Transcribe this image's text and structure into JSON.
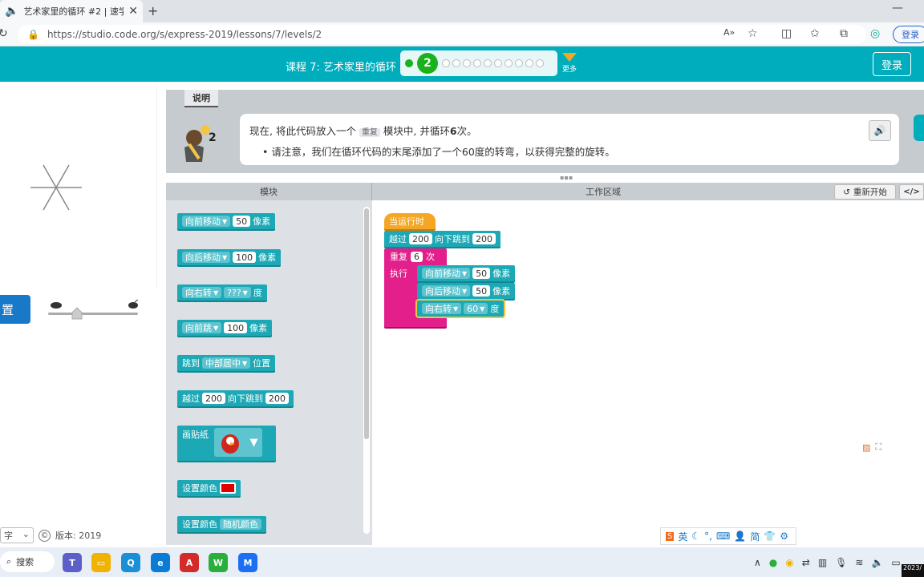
{
  "browser": {
    "tab_title": "艺术家里的循环 #2 | 速学课",
    "url": "https://studio.code.org/s/express-2019/lessons/7/levels/2",
    "login_pill": "登录"
  },
  "header": {
    "lesson_title": "课程 7: 艺术家里的循环",
    "current_level": "2",
    "more_label": "更多",
    "signin_label": "登录"
  },
  "viz": {
    "reset_label": "置",
    "footer_lang": "字",
    "footer_version": "版本: 2019",
    "footer_copyright": "©"
  },
  "instructions": {
    "tab_label": "说明",
    "line1_pre": "现在, 将此代码放入一个",
    "line1_kw": "重复",
    "line1_mid": "模块中, 并循环",
    "line1_num": "6",
    "line1_post": "次。",
    "bullet": "请注意，我们在循环代码的末尾添加了一个60度的转弯，以获得完整的旋转。",
    "avatar_badge": "2"
  },
  "workspace": {
    "toolbox_header": "模块",
    "workarea_header": "工作区域",
    "restart_label": "重新开始",
    "code_toggle_label": "</>"
  },
  "toolbox_blocks": {
    "b1": {
      "action": "向前移动",
      "value": "50",
      "unit": "像素"
    },
    "b2": {
      "action": "向后移动",
      "value": "100",
      "unit": "像素"
    },
    "b3": {
      "action": "向右转",
      "value": "???",
      "unit": "度"
    },
    "b4": {
      "action": "向前跳",
      "value": "100",
      "unit": "像素"
    },
    "b5": {
      "pre": "跳到",
      "value": "中部居中",
      "post": "位置"
    },
    "b6": {
      "pre": "越过",
      "x": "200",
      "mid": "向下跳到",
      "y": "200"
    },
    "b7": {
      "label": "画贴纸"
    },
    "b8": {
      "label": "设置颜色",
      "color": "#e00000"
    },
    "b9": {
      "label": "设置颜色",
      "value": "随机颜色"
    }
  },
  "program": {
    "event": "当运行时",
    "jump": {
      "pre": "越过",
      "x": "200",
      "mid": "向下跳到",
      "y": "200"
    },
    "repeat": {
      "label": "重复",
      "count": "6",
      "unit": "次",
      "do": "执行"
    },
    "inner": [
      {
        "action": "向前移动",
        "value": "50",
        "unit": "像素"
      },
      {
        "action": "向后移动",
        "value": "50",
        "unit": "像素"
      },
      {
        "action": "向右转",
        "value": "60",
        "unit": "度"
      }
    ]
  },
  "ime": {
    "lang": "英",
    "mode": "简"
  },
  "taskbar": {
    "search_label": "搜索",
    "clock": "2023/"
  },
  "colors": {
    "brand": "#00adbc",
    "motion_block": "#1ca8b5",
    "loop_block": "#e21f8a",
    "event_block": "#f5a623",
    "progress_green": "#1ab11a"
  }
}
